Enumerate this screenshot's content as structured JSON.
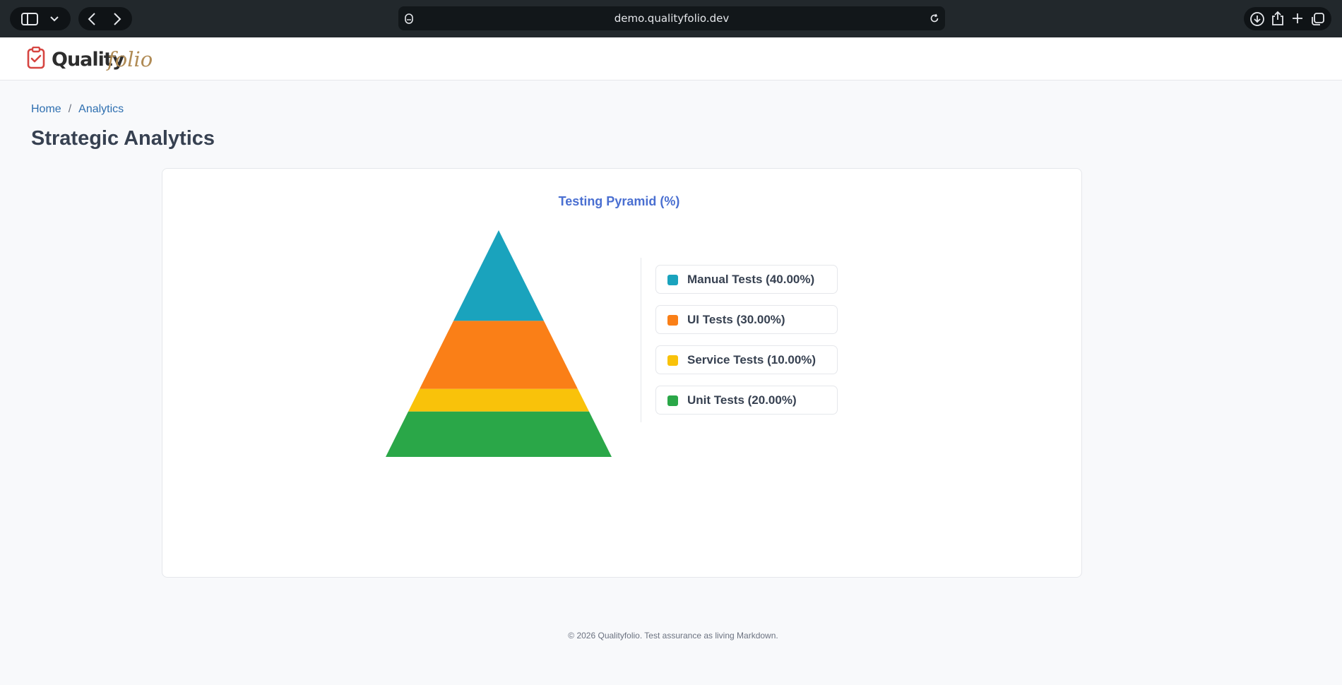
{
  "browser": {
    "url": "demo.qualityfolio.dev"
  },
  "site": {
    "brand_strong": "Quality",
    "brand_italic": "folio",
    "accent_brand": "#b08b55",
    "logo_color": "#d64541"
  },
  "breadcrumb": {
    "home": "Home",
    "separator": "/",
    "current": "Analytics"
  },
  "page": {
    "title": "Strategic Analytics"
  },
  "chart_data": {
    "type": "pyramid",
    "title": "Testing Pyramid (%)",
    "series": [
      {
        "name": "Manual Tests",
        "value": 40.0,
        "label": "Manual Tests (40.00%)",
        "color": "#1aa3bd"
      },
      {
        "name": "UI Tests",
        "value": 30.0,
        "label": "UI Tests (30.00%)",
        "color": "#fa7f17"
      },
      {
        "name": "Service Tests",
        "value": 10.0,
        "label": "Service Tests (10.00%)",
        "color": "#f9c20a"
      },
      {
        "name": "Unit Tests",
        "value": 20.0,
        "label": "Unit Tests (20.00%)",
        "color": "#2aa748"
      }
    ],
    "legend_position": "right"
  },
  "footer": {
    "text": "© 2026 Qualityfolio. Test assurance as living Markdown."
  }
}
